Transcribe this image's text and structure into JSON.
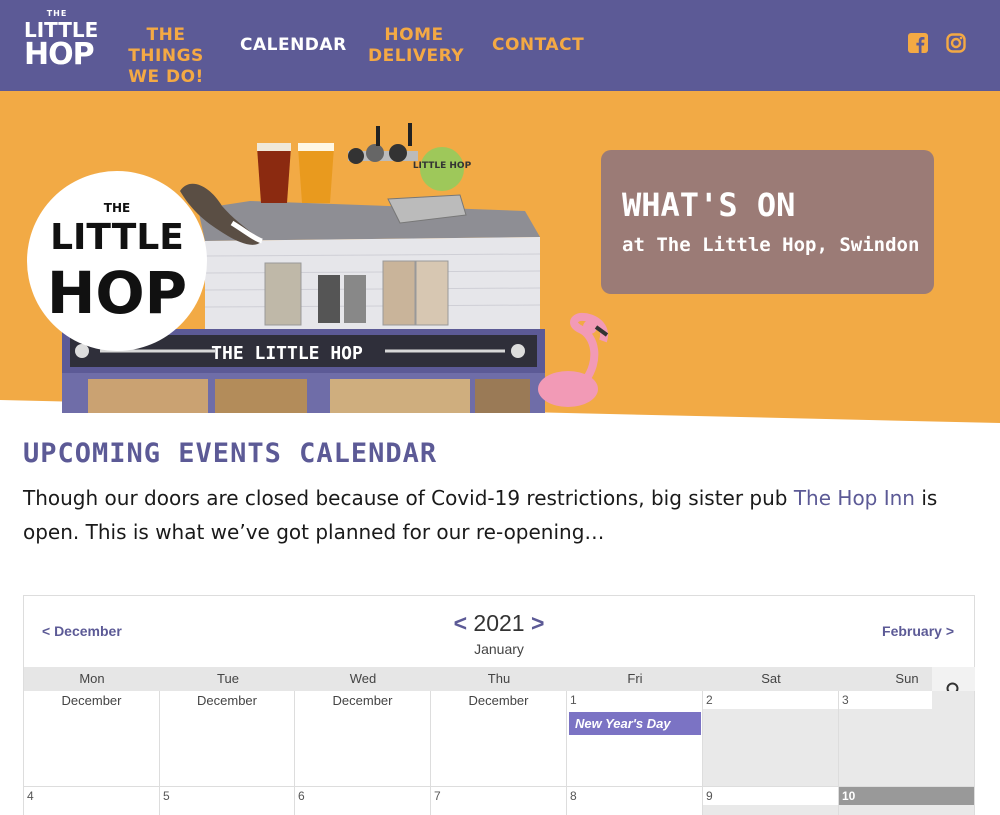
{
  "brand": {
    "logo_the": "THE",
    "logo_little": "LITTLE",
    "logo_hop": "HOP",
    "primary_color": "#5c5a96",
    "accent_color": "#f4a944"
  },
  "nav": {
    "things_line1": "THE THINGS",
    "things_line2": "WE DO!",
    "calendar": "CALENDAR",
    "home_line1": "HOME",
    "home_line2": "DELIVERY",
    "contact": "CONTACT",
    "social": [
      "facebook-icon",
      "instagram-icon"
    ]
  },
  "hero": {
    "title": "WHAT'S ON",
    "subtitle": "at The Little Hop, Swindon",
    "badge_the": "THE",
    "badge_little": "LITTLE",
    "badge_hop": "HOP",
    "pub_sign": "THE LITTLE HOP",
    "tap_label": "LITTLE HOP",
    "background_color": "#f2aa45"
  },
  "content": {
    "heading": "UPCOMING EVENTS CALENDAR",
    "intro_before": "Though our doors are closed because of Covid-19 restrictions, big sister pub ",
    "intro_link": "The Hop Inn",
    "intro_after": " is open. This is what we’ve got planned for our re-opening…"
  },
  "calendar": {
    "prev_month": "< December",
    "next_month": "February >",
    "year": "2021",
    "prev_year_arrow": "<",
    "next_year_arrow": ">",
    "month": "January",
    "weekdays": [
      "Mon",
      "Tue",
      "Wed",
      "Thu",
      "Fri",
      "Sat",
      "Sun"
    ],
    "week1": [
      "December",
      "December",
      "December",
      "December",
      "1",
      "2",
      "3"
    ],
    "week2": [
      "4",
      "5",
      "6",
      "7",
      "8",
      "9",
      "10"
    ],
    "event_new_year": "New Year's Day"
  }
}
